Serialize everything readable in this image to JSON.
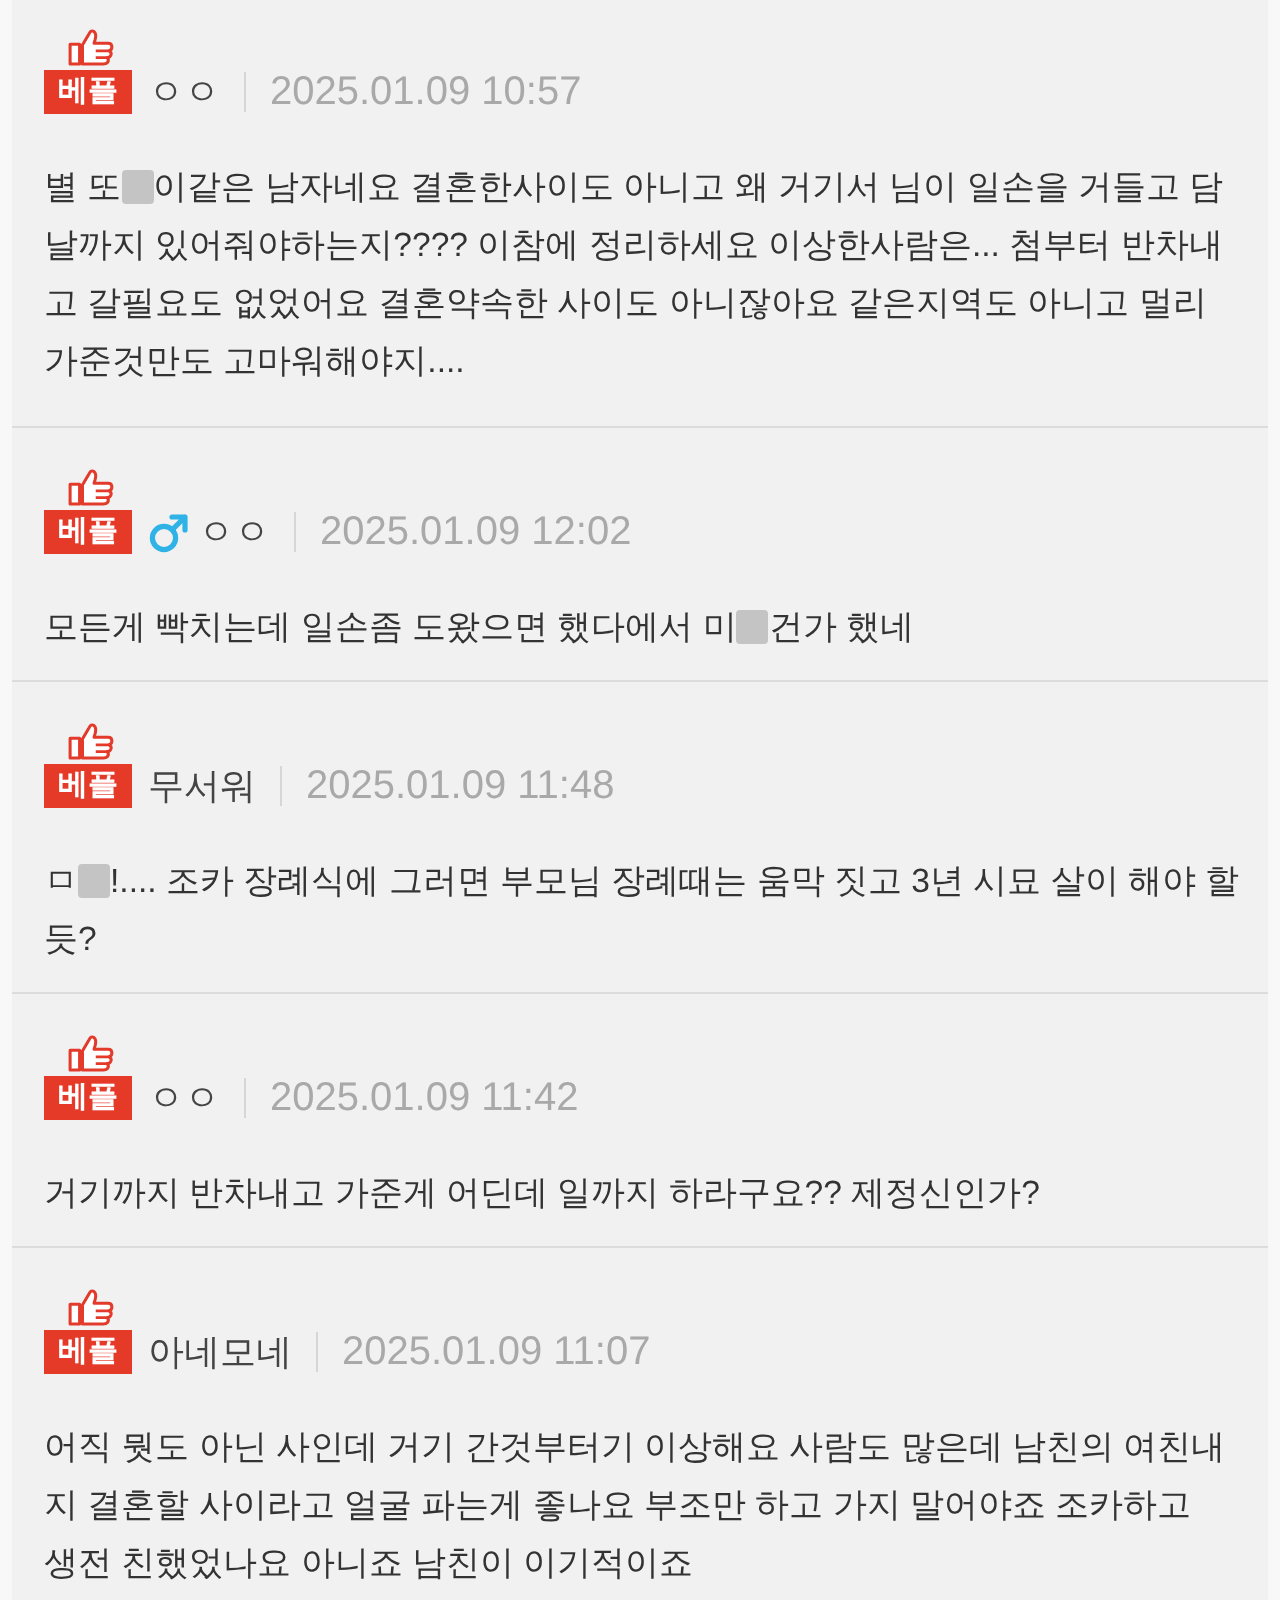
{
  "comments": [
    {
      "badge": "베플",
      "user": "ㅇㅇ",
      "date": "2025.01.09 10:57",
      "lines": [
        [
          {
            "kind": "text",
            "text": "별 또"
          },
          {
            "kind": "blur"
          },
          {
            "kind": "text",
            "text": "이같은 남자네요 결혼한사이도 아니고 왜 거기서 님이 일손을 거들고 담"
          }
        ],
        [
          {
            "kind": "text",
            "text": "날까지 있어줘야하는지???? 이참에 정리하세요 이상한사람은... 첨부터 반차내"
          }
        ],
        [
          {
            "kind": "text",
            "text": "고 갈필요도 없었어요 결혼약속한 사이도 아니잖아요 같은지역도 아니고 멀리"
          }
        ],
        [
          {
            "kind": "text",
            "text": "가준것만도 고마워해야지...."
          }
        ]
      ]
    },
    {
      "badge": "베플",
      "gender_icon": {
        "kind": "male"
      },
      "user": "ㅇㅇ",
      "date": "2025.01.09 12:02",
      "lines": [
        [
          {
            "kind": "text",
            "text": "모든게 빡치는데 일손좀 도왔으면 했다에서 미"
          },
          {
            "kind": "blur"
          },
          {
            "kind": "text",
            "text": "건가 했네"
          }
        ]
      ]
    },
    {
      "badge": "베플",
      "user": "무서워",
      "date": "2025.01.09 11:48",
      "lines": [
        [
          {
            "kind": "text",
            "text": "ㅁ"
          },
          {
            "kind": "blur"
          },
          {
            "kind": "text",
            "text": "!.... 조카 장례식에 그러면 부모님 장례때는 움막 짓고 3년 시묘 살이 해야 할"
          }
        ],
        [
          {
            "kind": "text",
            "text": "듯?"
          }
        ]
      ]
    },
    {
      "badge": "베플",
      "user": "ㅇㅇ",
      "date": "2025.01.09 11:42",
      "lines": [
        [
          {
            "kind": "text",
            "text": "거기까지 반차내고 가준게 어딘데 일까지 하라구요?? 제정신인가?"
          }
        ]
      ]
    },
    {
      "badge": "베플",
      "user": "아네모네",
      "date": "2025.01.09 11:07",
      "lines": [
        [
          {
            "kind": "text",
            "text": "어직 뭣도 아닌 사인데 거기 간것부터기 이상해요 사람도 많은데 남친의 여친내"
          }
        ],
        [
          {
            "kind": "text",
            "text": "지 결혼할 사이라고 얼굴 파는게 좋나요 부조만 하고 가지 말어야죠 조카하고"
          }
        ],
        [
          {
            "kind": "text",
            "text": "생전 친했었나요 아니죠 남친이 이기적이죠"
          }
        ]
      ]
    }
  ]
}
